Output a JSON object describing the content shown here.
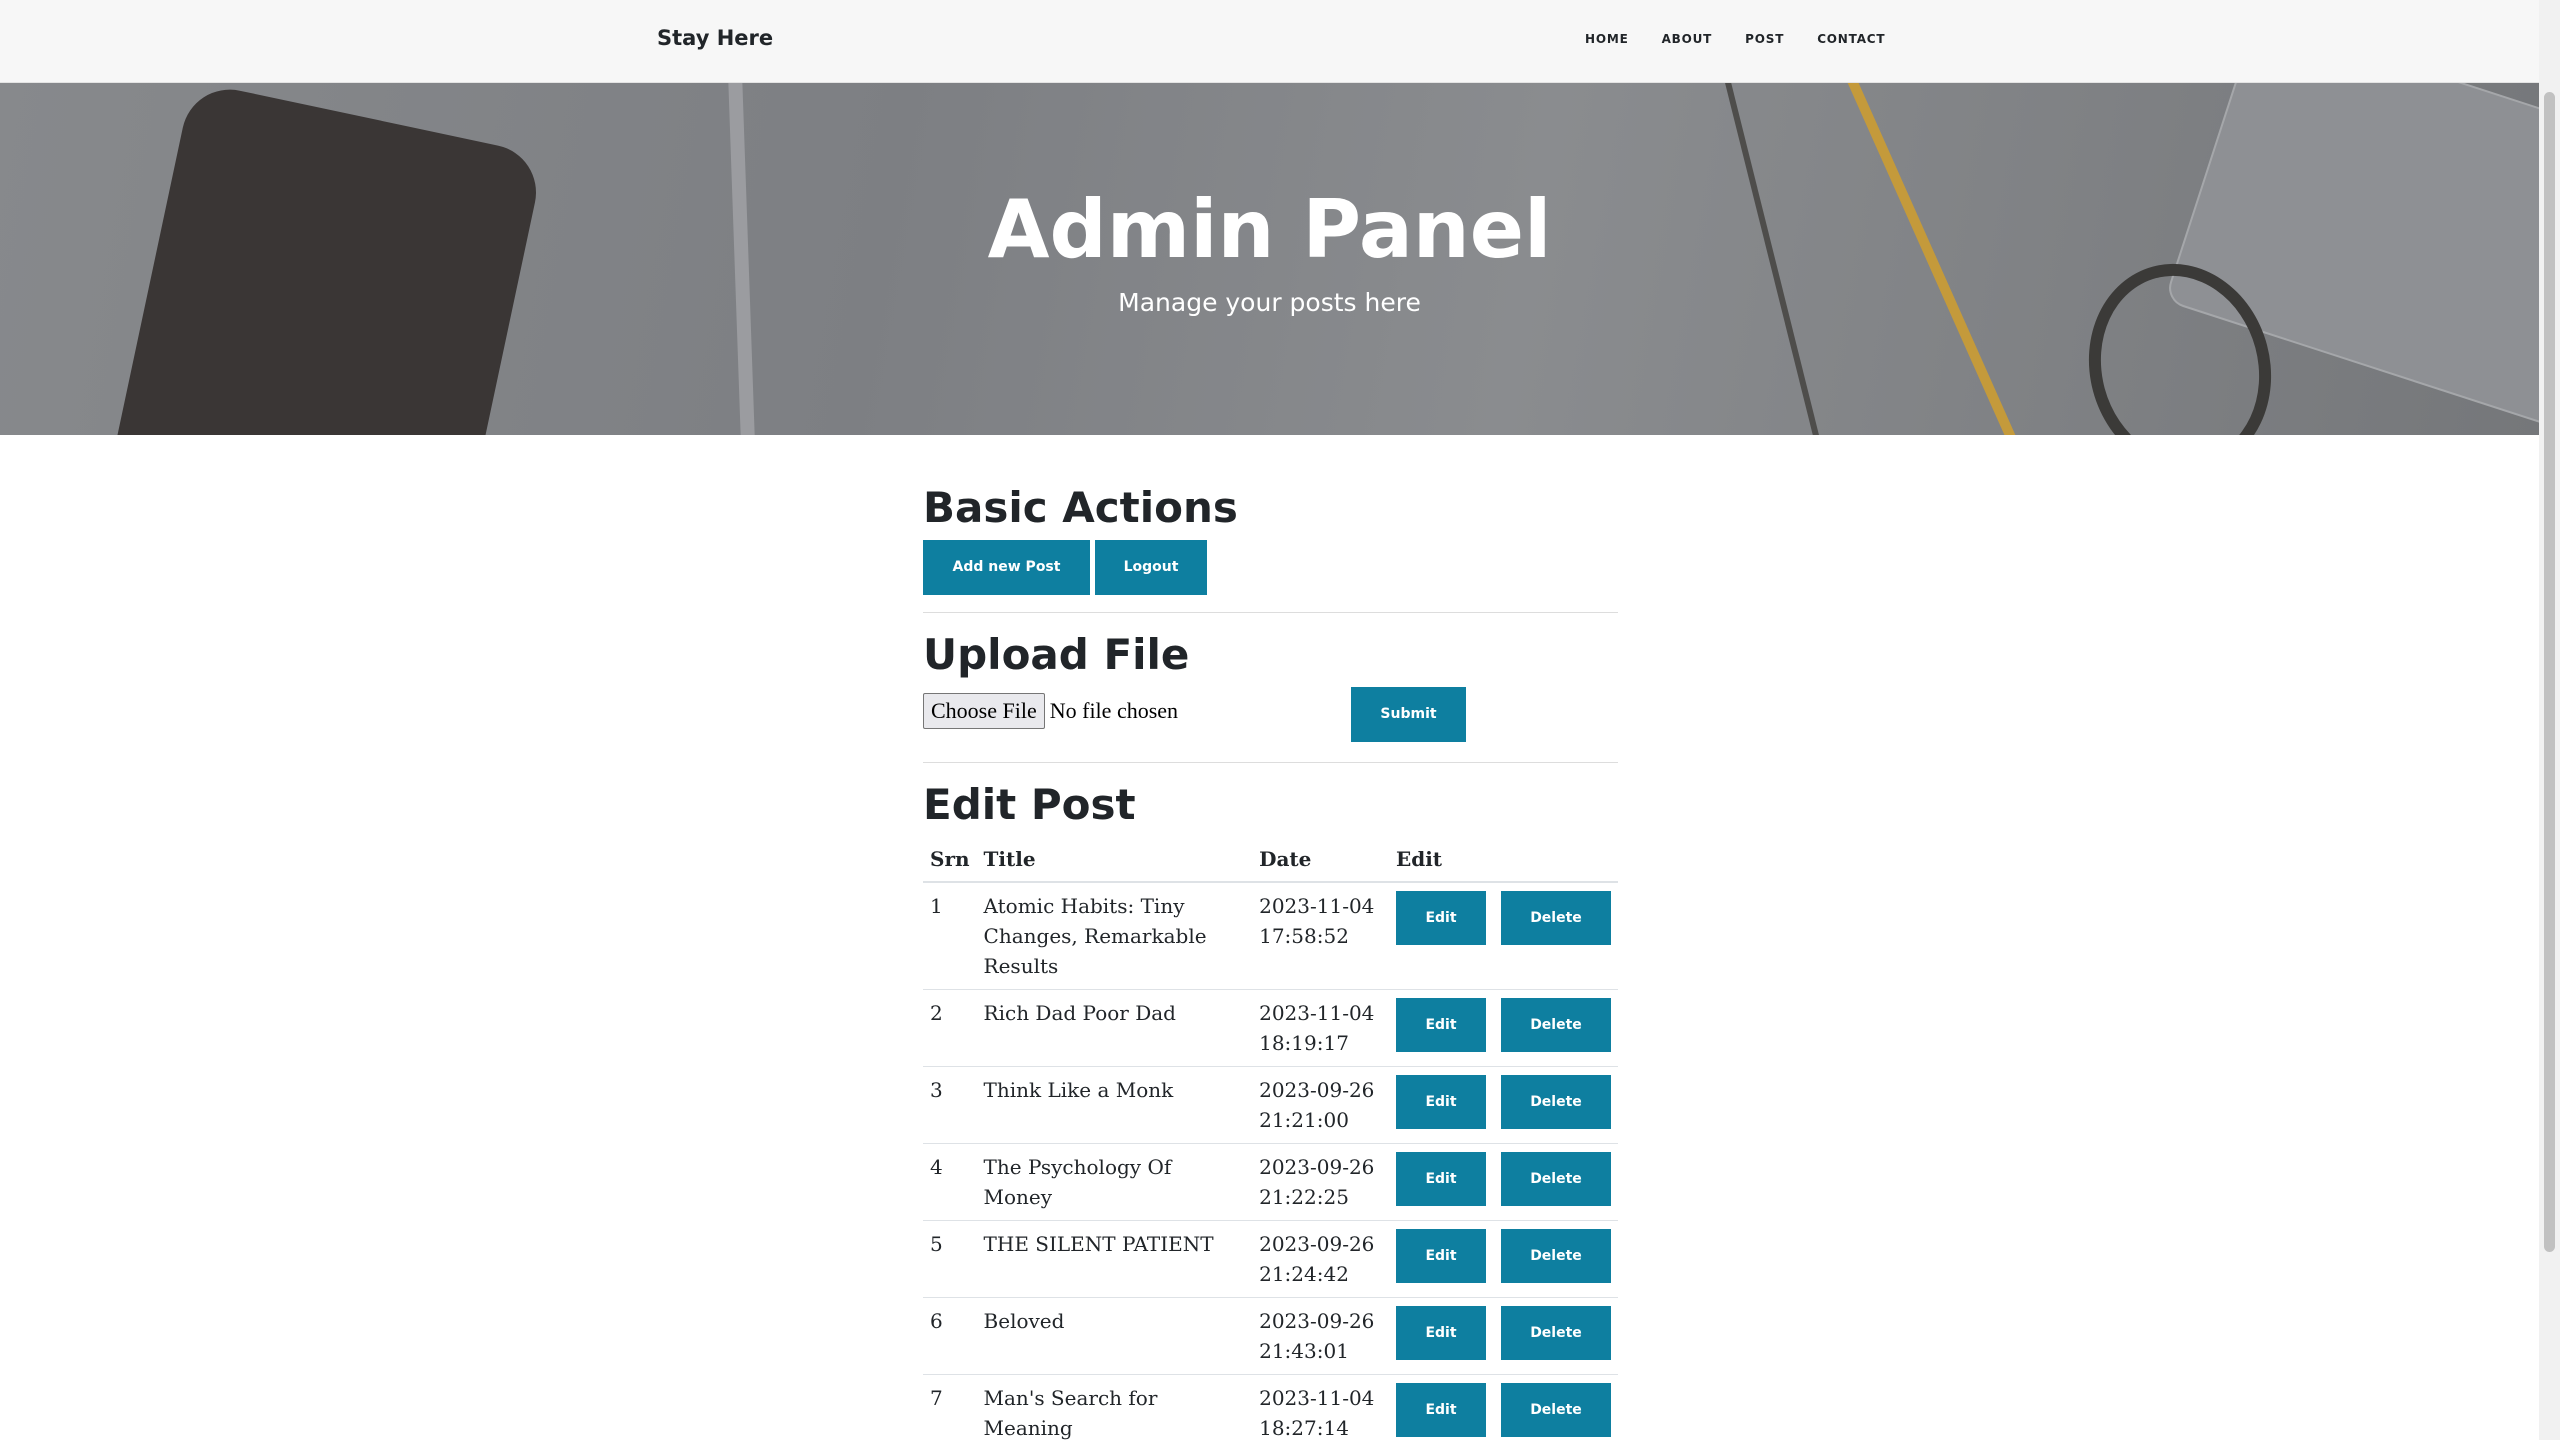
{
  "navbar": {
    "brand": "Stay Here",
    "links": [
      "HOME",
      "ABOUT",
      "POST",
      "CONTACT"
    ]
  },
  "hero": {
    "title": "Admin Panel",
    "subtitle": "Manage your posts here"
  },
  "basic_actions": {
    "heading": "Basic Actions",
    "add_post_label": "Add new Post",
    "logout_label": "Logout"
  },
  "upload": {
    "heading": "Upload File",
    "choose_file_label": "Choose File",
    "no_file_text": "No file chosen",
    "submit_label": "Submit"
  },
  "edit_post": {
    "heading": "Edit Post",
    "columns": [
      "Srn",
      "Title",
      "Date",
      "Edit"
    ],
    "edit_label": "Edit",
    "delete_label": "Delete",
    "rows": [
      {
        "srn": "1",
        "title": "Atomic Habits: Tiny Changes, Remarkable Results",
        "date": "2023-11-04 17:58:52"
      },
      {
        "srn": "2",
        "title": "Rich Dad Poor Dad",
        "date": "2023-11-04 18:19:17"
      },
      {
        "srn": "3",
        "title": "Think Like a Monk",
        "date": "2023-09-26 21:21:00"
      },
      {
        "srn": "4",
        "title": "The Psychology Of Money",
        "date": "2023-09-26 21:22:25"
      },
      {
        "srn": "5",
        "title": "THE SILENT PATIENT",
        "date": "2023-09-26 21:24:42"
      },
      {
        "srn": "6",
        "title": "Beloved",
        "date": "2023-09-26 21:43:01"
      },
      {
        "srn": "7",
        "title": "Man's Search for Meaning",
        "date": "2023-11-04 18:27:14"
      }
    ]
  },
  "colors": {
    "accent": "#0e7fa0",
    "navbar_bg": "#f7f7f7"
  }
}
